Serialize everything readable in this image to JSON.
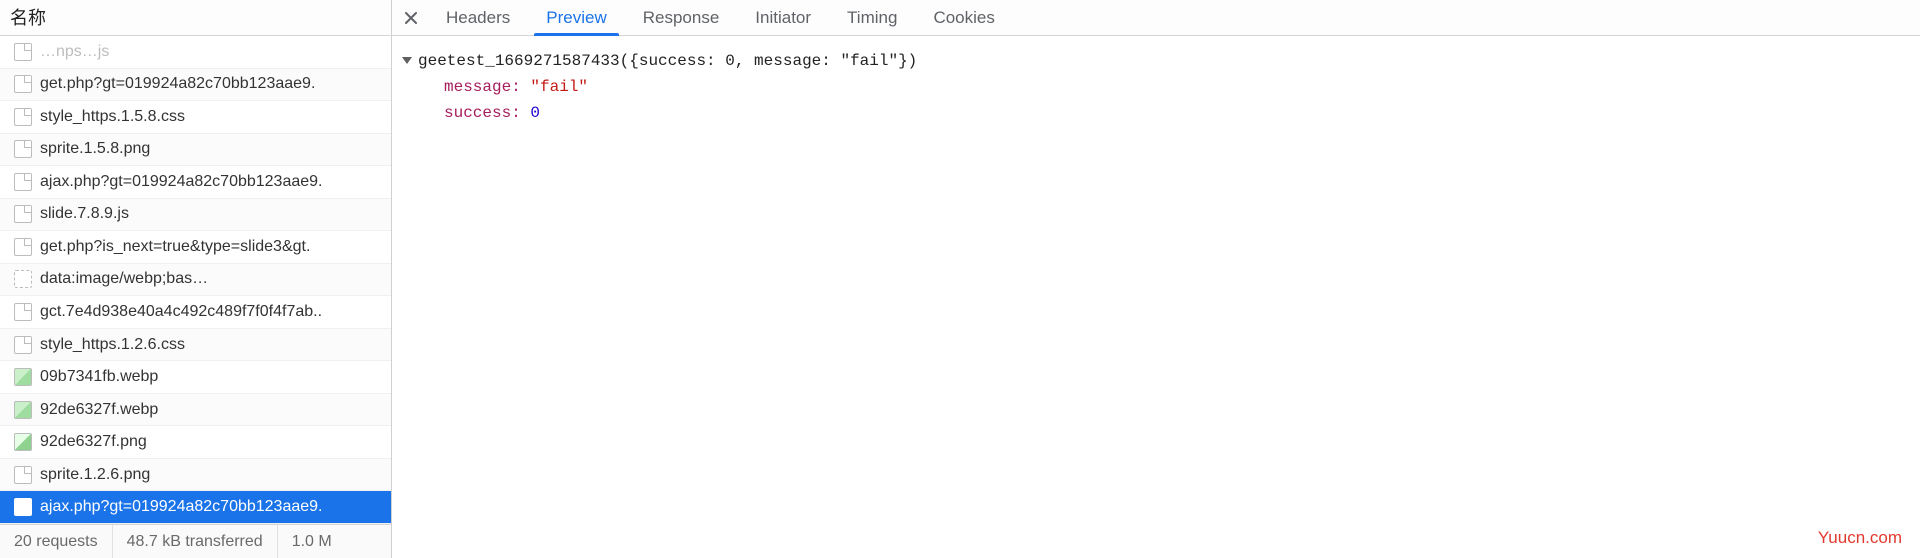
{
  "left": {
    "header": "名称",
    "requests": [
      {
        "name": "…nps…js",
        "iconType": "doc",
        "partial": true
      },
      {
        "name": "get.php?gt=019924a82c70bb123aae9.",
        "iconType": "doc"
      },
      {
        "name": "style_https.1.5.8.css",
        "iconType": "doc"
      },
      {
        "name": "sprite.1.5.8.png",
        "iconType": "doc"
      },
      {
        "name": "ajax.php?gt=019924a82c70bb123aae9.",
        "iconType": "doc"
      },
      {
        "name": "slide.7.8.9.js",
        "iconType": "doc"
      },
      {
        "name": "get.php?is_next=true&type=slide3&gt.",
        "iconType": "doc"
      },
      {
        "name": "data:image/webp;bas…",
        "iconType": "data"
      },
      {
        "name": "gct.7e4d938e40a4c492c489f7f0f4f7ab..",
        "iconType": "doc"
      },
      {
        "name": "style_https.1.2.6.css",
        "iconType": "doc"
      },
      {
        "name": "09b7341fb.webp",
        "iconType": "img"
      },
      {
        "name": "92de6327f.webp",
        "iconType": "img"
      },
      {
        "name": "92de6327f.png",
        "iconType": "img2"
      },
      {
        "name": "sprite.1.2.6.png",
        "iconType": "doc"
      },
      {
        "name": "ajax.php?gt=019924a82c70bb123aae9.",
        "iconType": "docsel",
        "selected": true
      }
    ],
    "status": {
      "requests": "20 requests",
      "transferred": "48.7 kB transferred",
      "resources": "1.0 M"
    }
  },
  "tabs": {
    "items": [
      "Headers",
      "Preview",
      "Response",
      "Initiator",
      "Timing",
      "Cookies"
    ],
    "activeIndex": 1
  },
  "preview": {
    "callback_line": "geetest_1669271587433({success: 0, message: \"fail\"})",
    "entries": [
      {
        "key": "message:",
        "type": "str",
        "value": "\"fail\""
      },
      {
        "key": "success:",
        "type": "num",
        "value": "0"
      }
    ]
  },
  "watermark": "Yuucn.com"
}
